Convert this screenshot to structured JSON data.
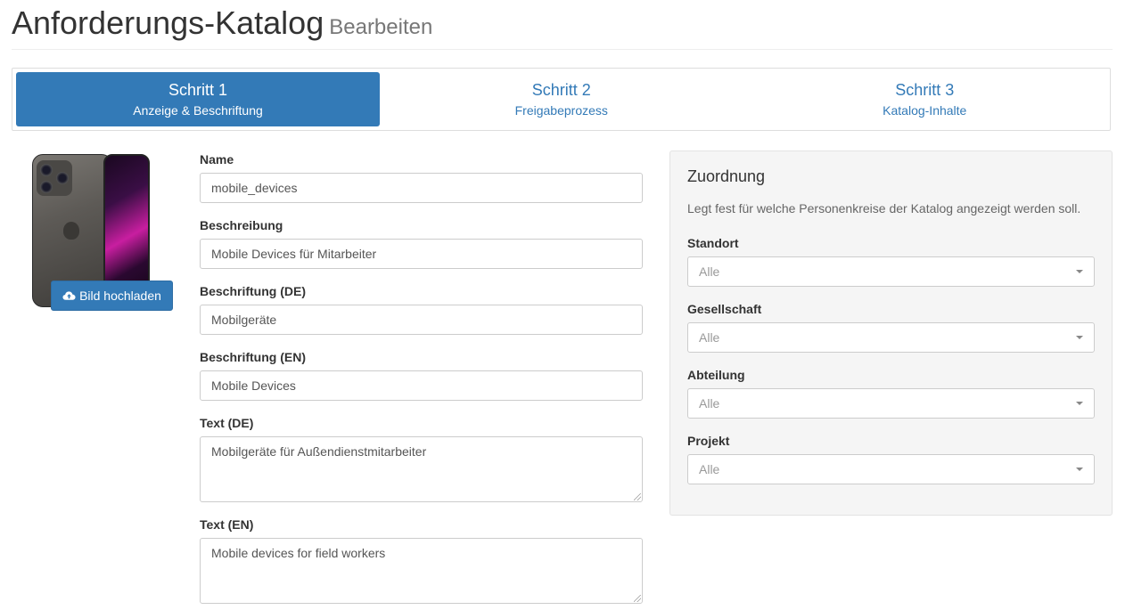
{
  "header": {
    "title": "Anforderungs-Katalog",
    "subtitle": "Bearbeiten"
  },
  "wizard": {
    "steps": [
      {
        "title": "Schritt 1",
        "subtitle": "Anzeige & Beschriftung",
        "active": true
      },
      {
        "title": "Schritt 2",
        "subtitle": "Freigabeprozess",
        "active": false
      },
      {
        "title": "Schritt 3",
        "subtitle": "Katalog-Inhalte",
        "active": false
      }
    ]
  },
  "image": {
    "upload_label": "Bild hochladen",
    "icon": "cloud-upload-icon"
  },
  "form": {
    "name": {
      "label": "Name",
      "value": "mobile_devices"
    },
    "description": {
      "label": "Beschreibung",
      "value": "Mobile Devices für Mitarbeiter"
    },
    "caption_de": {
      "label": "Beschriftung (DE)",
      "value": "Mobilgeräte"
    },
    "caption_en": {
      "label": "Beschriftung (EN)",
      "value": "Mobile Devices"
    },
    "text_de": {
      "label": "Text (DE)",
      "value": "Mobilgeräte für Außendienstmitarbeiter"
    },
    "text_en": {
      "label": "Text (EN)",
      "value": "Mobile devices for field workers"
    }
  },
  "assignment": {
    "title": "Zuordnung",
    "description": "Legt fest für welche Personenkreise der Katalog angezeigt werden soll.",
    "fields": [
      {
        "label": "Standort",
        "value": "Alle"
      },
      {
        "label": "Gesellschaft",
        "value": "Alle"
      },
      {
        "label": "Abteilung",
        "value": "Alle"
      },
      {
        "label": "Projekt",
        "value": "Alle"
      }
    ]
  },
  "colors": {
    "primary": "#337ab7",
    "panel_bg": "#f5f5f5",
    "border": "#cccccc"
  }
}
